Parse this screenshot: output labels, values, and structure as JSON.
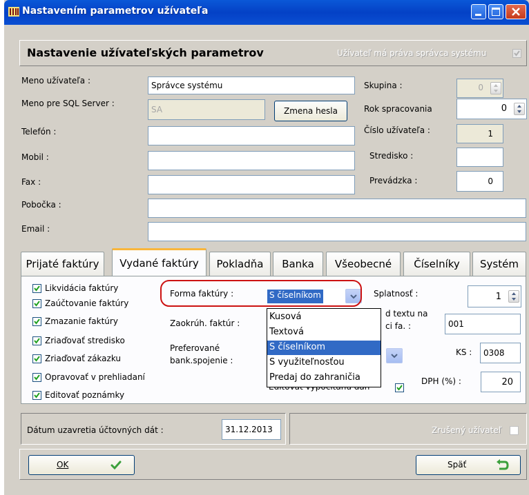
{
  "window": {
    "title": "Nastavením parametrov užívateľa"
  },
  "header": {
    "title": "Nastavenie užívateľských parametrov",
    "admin_rights_label": "Užívateľ má práva správca systému",
    "admin_rights_checked": true
  },
  "fields": {
    "meno_label": "Meno užívateľa :",
    "meno_value": "Správce systému",
    "sql_label": "Meno pre SQL Server :",
    "sql_value": "SA",
    "zmena_hesla": "Zmena hesla",
    "telefon_label": "Telefón :",
    "telefon_value": "",
    "mobil_label": "Mobil :",
    "mobil_value": "",
    "fax_label": "Fax :",
    "fax_value": "",
    "pobocka_label": "Pobočka :",
    "pobocka_value": "",
    "email_label": "Email :",
    "email_value": "",
    "skupina_label": "Skupina :",
    "skupina_value": "0",
    "rok_label": "Rok spracovania",
    "rok_value": "0",
    "cislo_label": "Číslo užívateľa :",
    "cislo_value": "1",
    "stredisko_label": "Stredisko :",
    "stredisko_value": "",
    "prevadzka_label": "Prevádzka :",
    "prevadzka_value": "0"
  },
  "tabs": [
    {
      "label": "Prijaté faktúry",
      "active": false
    },
    {
      "label": "Vydané faktúry",
      "active": true
    },
    {
      "label": "Pokladňa",
      "active": false
    },
    {
      "label": "Banka",
      "active": false
    },
    {
      "label": "Všeobecné",
      "active": false
    },
    {
      "label": "Číselníky",
      "active": false
    },
    {
      "label": "Systém",
      "active": false
    }
  ],
  "checkboxes": [
    {
      "label": "Likvidácia faktúry",
      "checked": true
    },
    {
      "label": "Zaúčtovanie faktúry",
      "checked": true
    },
    {
      "label": "Zmazanie faktúry",
      "checked": true
    },
    {
      "label": "Zriaďovať stredisko",
      "checked": true
    },
    {
      "label": "Zriaďovať zákazku",
      "checked": true
    },
    {
      "label": "Opravovať v prehliadaní",
      "checked": true
    },
    {
      "label": "Editovať poznámky",
      "checked": true
    }
  ],
  "tab_fields": {
    "forma_label": "Forma faktúry :",
    "forma_value": "S číselníkom",
    "forma_options": [
      "Kusová",
      "Textová",
      "S číselníkom",
      "S využiteľnosťou",
      "Predaj do zahraničia"
    ],
    "forma_selected_index": 2,
    "zaokruh_label": "Zaokrúh. faktúr :",
    "preferovane_label_1": "Preferované",
    "preferovane_label_2": "bank.spojenie :",
    "splatnost_label": "Splatnosť :",
    "splatnost_value": "1",
    "kod_textu_label_1": "d textu na",
    "kod_textu_label_2": "ci fa. :",
    "kod_textu_value": "001",
    "ks_label": "KS :",
    "ks_value": "0308",
    "dph_label": "DPH (%) :",
    "dph_value": "20",
    "editovat_dan_label": "Editovať vypočítanú daň",
    "editovat_dan_checked": true
  },
  "footer": {
    "datum_label": "Dátum uzavretia účtovných dát :",
    "datum_value": "31.12.2013",
    "zruseny_label": "Zrušený užívateľ",
    "zruseny_checked": false,
    "ok_label": "OK",
    "spat_label": "Späť"
  },
  "colors": {
    "titlebar": "#0441c6",
    "highlight_oval": "#cc1111",
    "selection": "#316ac5",
    "tab_accent": "#f9b63b",
    "check_green": "#21a121"
  }
}
